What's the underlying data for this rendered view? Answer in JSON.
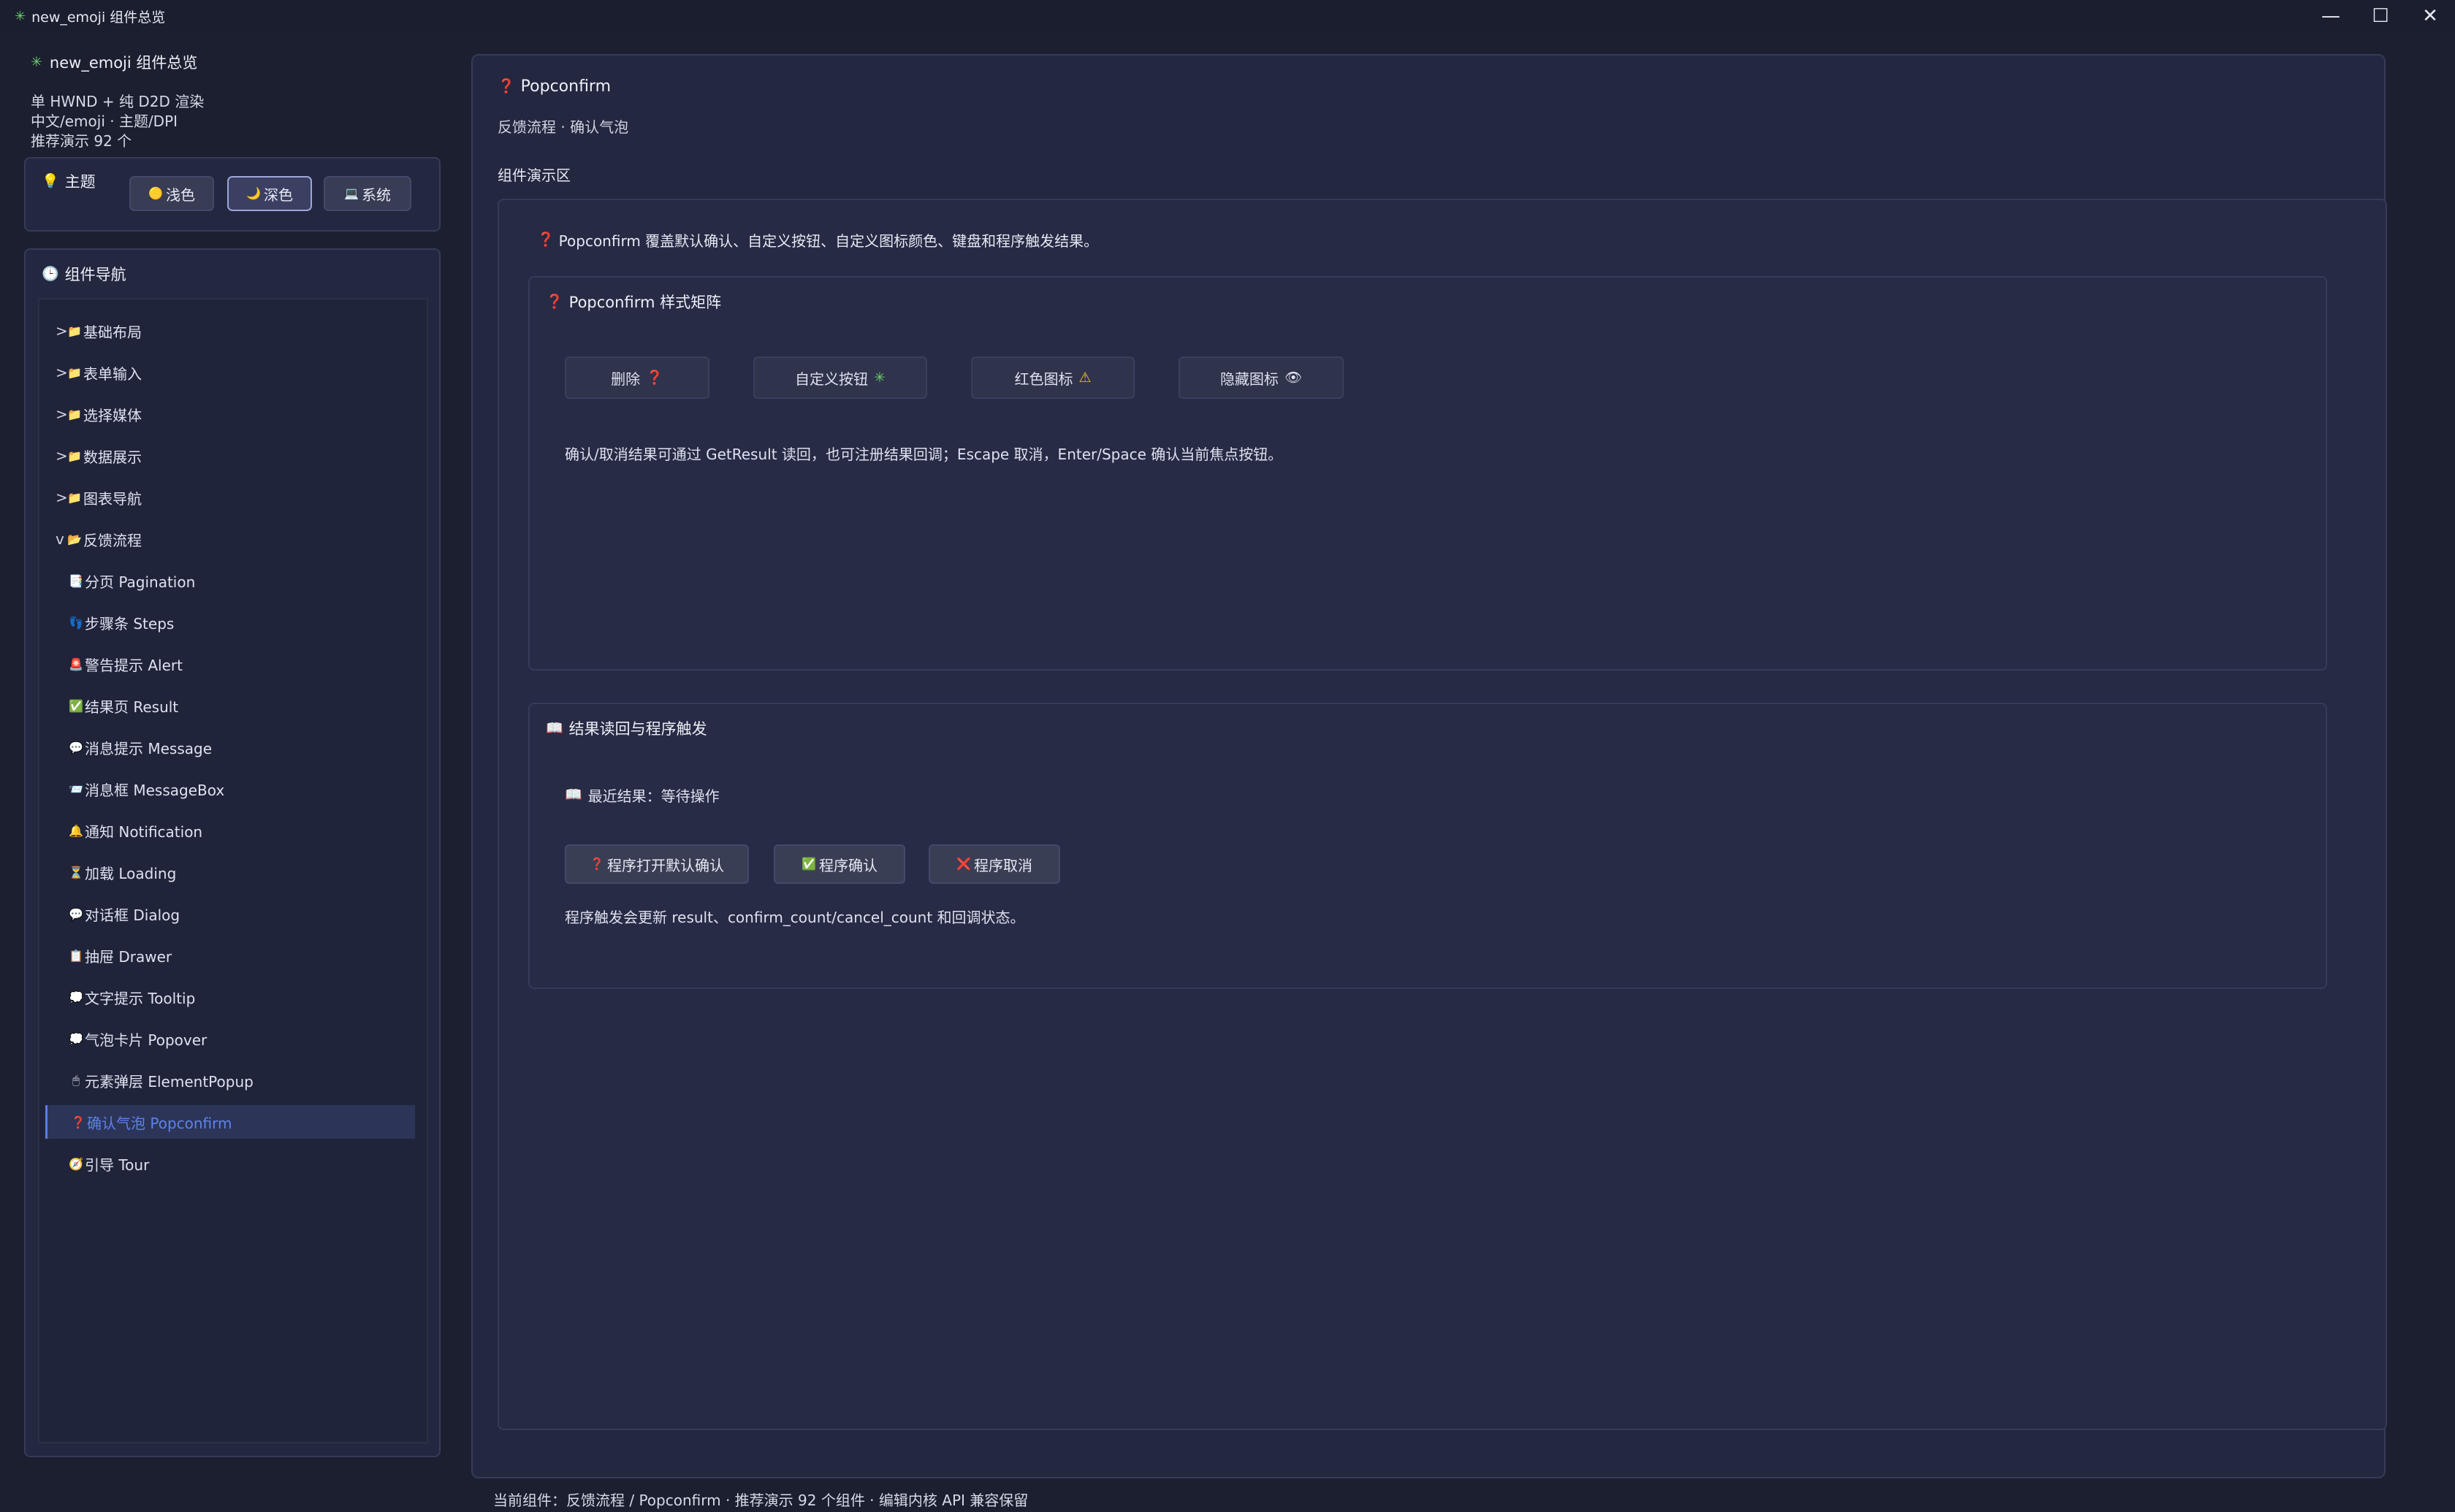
{
  "window": {
    "title": "new_emoji 组件总览",
    "minimize_glyph": "—",
    "maximize_glyph": "☐",
    "close_glyph": "✕"
  },
  "sidebar": {
    "app_name": "new_emoji 组件总览",
    "meta": [
      "单 HWND + 纯 D2D 渲染",
      "中文/emoji · 主题/DPI",
      "推荐演示 92 个"
    ],
    "theme": {
      "label": "主题",
      "options": [
        {
          "icon": "🟡",
          "label": "浅色"
        },
        {
          "icon": "🌙",
          "label": "深色",
          "active": true
        },
        {
          "icon": "💻",
          "label": "系统"
        }
      ]
    },
    "nav": {
      "title": "组件导航",
      "groups": [
        {
          "caret": ">",
          "label": "基础布局"
        },
        {
          "caret": ">",
          "label": "表单输入"
        },
        {
          "caret": ">",
          "label": "选择媒体"
        },
        {
          "caret": ">",
          "label": "数据展示"
        },
        {
          "caret": ">",
          "label": "图表导航"
        },
        {
          "caret": "v",
          "label": "反馈流程"
        }
      ],
      "children": [
        {
          "icon": "📑",
          "label": "分页 Pagination"
        },
        {
          "icon": "👣",
          "label": "步骤条 Steps"
        },
        {
          "icon": "🚨",
          "label": "警告提示 Alert"
        },
        {
          "icon": "✅",
          "label": "结果页 Result"
        },
        {
          "icon": "💬",
          "label": "消息提示 Message"
        },
        {
          "icon": "📨",
          "label": "消息框 MessageBox"
        },
        {
          "icon": "🔔",
          "label": "通知 Notification"
        },
        {
          "icon": "⏳",
          "label": "加载 Loading"
        },
        {
          "icon": "💬",
          "label": "对话框 Dialog"
        },
        {
          "icon": "📋",
          "label": "抽屉 Drawer"
        },
        {
          "icon": "💭",
          "label": "文字提示 Tooltip"
        },
        {
          "icon": "💭",
          "label": "气泡卡片 Popover"
        },
        {
          "icon": "🖱",
          "label": "元素弹层 ElementPopup"
        },
        {
          "icon": "❓",
          "label": "确认气泡 Popconfirm",
          "selected": true
        },
        {
          "icon": "🧭",
          "label": "引导 Tour"
        }
      ]
    }
  },
  "main": {
    "title": "Popconfirm",
    "crumb": "反馈流程 · 确认气泡",
    "demo_label": "组件演示区",
    "intro": "Popconfirm 覆盖默认确认、自定义按钮、自定义图标颜色、键盘和程序触发结果。",
    "style_card": {
      "title": "Popconfirm 样式矩阵",
      "buttons": [
        {
          "label": "删除",
          "icon": "❓"
        },
        {
          "label": "自定义按钮",
          "icon": "✳"
        },
        {
          "label": "红色图标",
          "icon": "⚠"
        },
        {
          "label": "隐藏图标",
          "icon": "👁"
        }
      ],
      "note": "确认/取消结果可通过 GetResult 读回，也可注册结果回调；Escape 取消，Enter/Space 确认当前焦点按钮。"
    },
    "result_card": {
      "title": "结果读回与程序触发",
      "latest": "最近结果：等待操作",
      "buttons": [
        {
          "icon": "❓",
          "label": "程序打开默认确认"
        },
        {
          "icon": "✅",
          "label": "程序确认"
        },
        {
          "icon": "❌",
          "label": "程序取消"
        }
      ],
      "note": "程序触发会更新 result、confirm_count/cancel_count 和回调状态。"
    }
  },
  "status": "当前组件：反馈流程 / Popconfirm · 推荐演示 92 个组件 · 编辑内核 API 兼容保留",
  "icons": {
    "app": "sparkle-icon",
    "theme": "bulb-icon",
    "nav": "clock-icon",
    "question": "❓",
    "card": "📖"
  }
}
